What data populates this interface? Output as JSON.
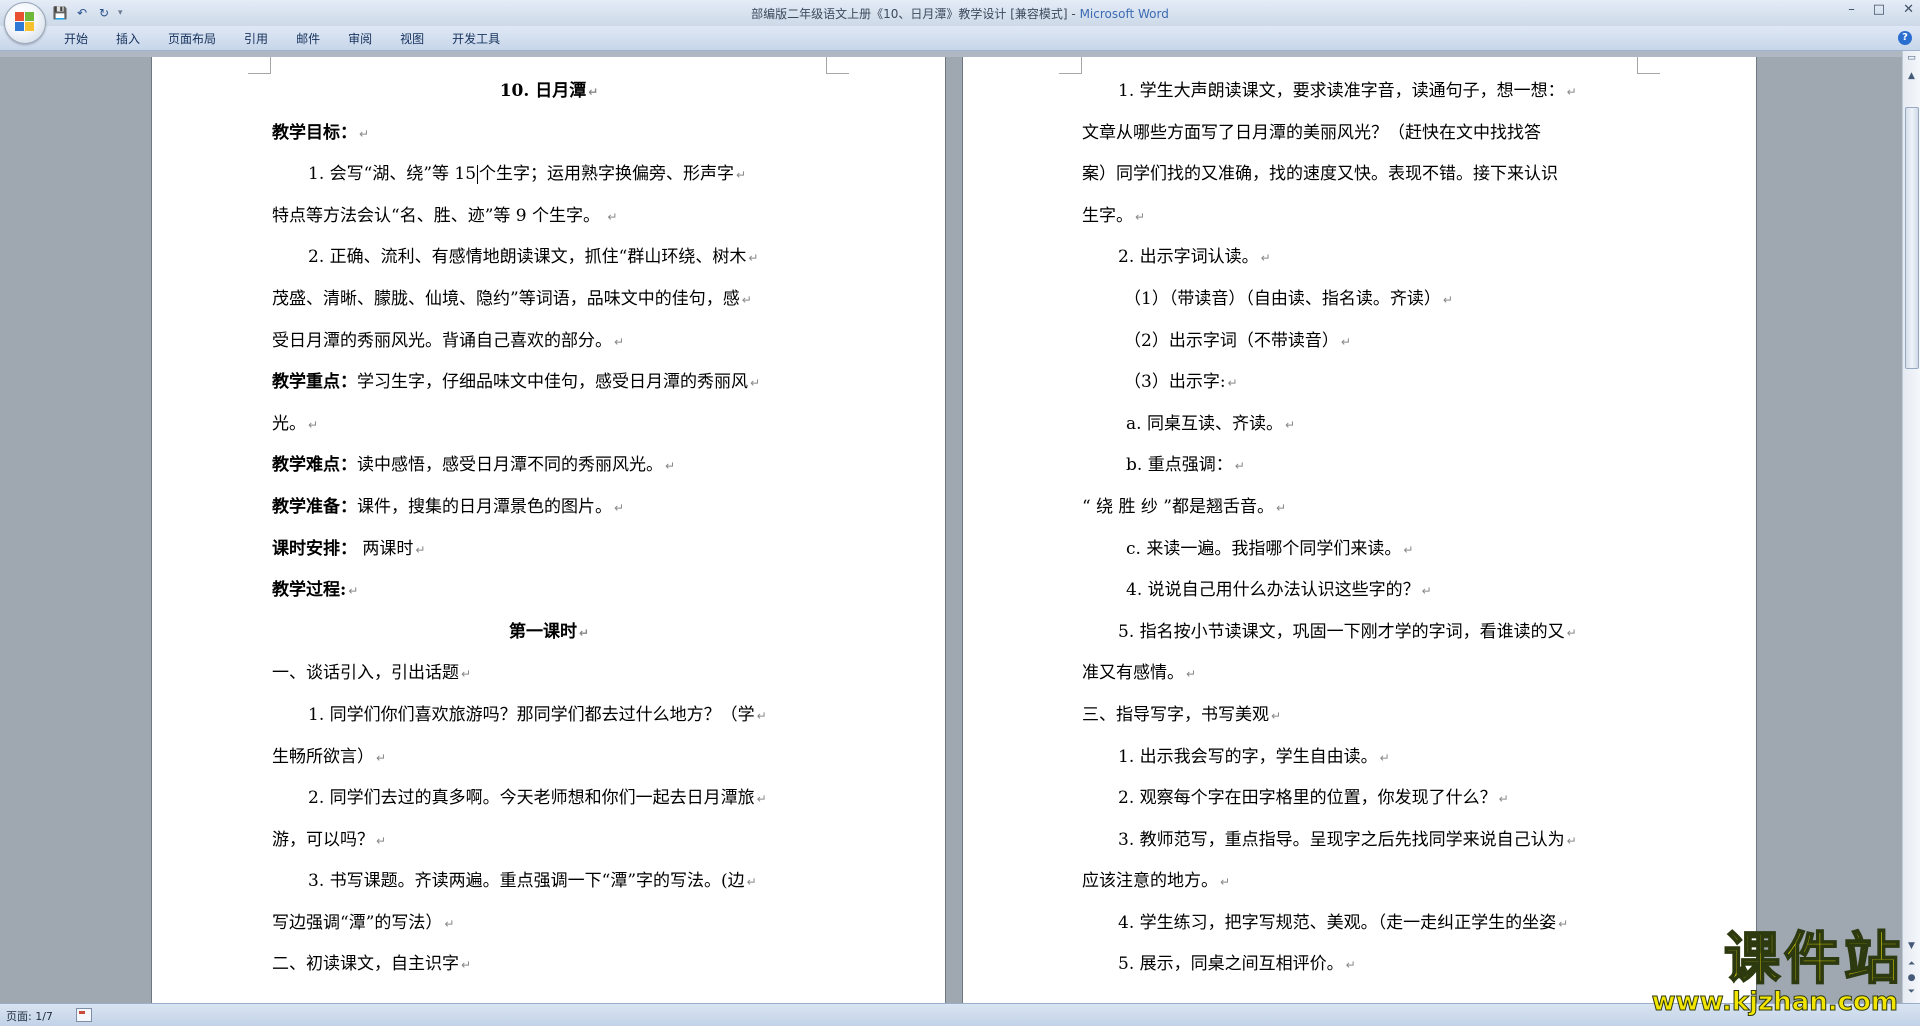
{
  "window": {
    "title": "部编版二年级语文上册《10、日月潭》教学设计 [兼容模式] - ",
    "app_name": "Microsoft Word",
    "controls": [
      "–",
      "□",
      "✕"
    ]
  },
  "quick_access": {
    "save_icon": "💾",
    "undo_icon": "↶",
    "redo_icon": "↻",
    "customize_icon": "▾"
  },
  "ribbon": {
    "tabs": [
      "开始",
      "插入",
      "页面布局",
      "引用",
      "邮件",
      "审阅",
      "视图",
      "开发工具"
    ],
    "help": "?"
  },
  "document": {
    "left_page": [
      {
        "text": "10. 日月潭",
        "style": "title"
      },
      {
        "label": "教学目标：",
        "text": ""
      },
      {
        "text": "1. 会写“湖、绕”等 15",
        "caret": true,
        "text2": "个生字；运用熟字换偏旁、形声字",
        "style": "ind"
      },
      {
        "text": "特点等方法会认“名、胜、迹”等 9 个生字。 "
      },
      {
        "text": "2. 正确、流利、有感情地朗读课文，抓住“群山环绕、树木",
        "style": "ind"
      },
      {
        "text": "茂盛、清晰、朦胧、仙境、隐约”等词语，品味文中的佳句，感"
      },
      {
        "text": "受日月潭的秀丽风光。背诵自己喜欢的部分。"
      },
      {
        "label": "教学重点：",
        "text": "学习生字，仔细品味文中佳句，感受日月潭的秀丽风"
      },
      {
        "text": "光。"
      },
      {
        "label": "教学难点：",
        "text": "读中感悟，感受日月潭不同的秀丽风光。"
      },
      {
        "label": "教学准备：",
        "text": "课件，搜集的日月潭景色的图片。"
      },
      {
        "label": "课时安排：",
        "text": " 两课时"
      },
      {
        "label": "教学过程:",
        "text": ""
      },
      {
        "text": "第一课时",
        "style": "title"
      },
      {
        "text": "一、谈话引入，引出话题"
      },
      {
        "text": "1. 同学们你们喜欢旅游吗？那同学们都去过什么地方？（学",
        "style": "ind"
      },
      {
        "text": "生畅所欲言）"
      },
      {
        "text": "2. 同学们去过的真多啊。今天老师想和你们一起去日月潭旅",
        "style": "ind"
      },
      {
        "text": "游，可以吗？"
      },
      {
        "text": "3. 书写课题。齐读两遍。重点强调一下“潭”字的写法。(边",
        "style": "ind"
      },
      {
        "text": "写边强调“潭”的写法）"
      },
      {
        "text": "二、初读课文，自主识字"
      }
    ],
    "right_page": [
      {
        "text": "1. 学生大声朗读课文，要求读准字音，读通句子，想一想：",
        "style": "ind"
      },
      {
        "text": "文章从哪些方面写了日月潭的美丽风光？（赶快在文中找找答",
        "mark": false
      },
      {
        "text": "案）同学们找的又准确，找的速度又快。表现不错。接下来认识",
        "mark": false
      },
      {
        "text": "生字。"
      },
      {
        "text": "2. 出示字词认读。",
        "style": "ind"
      },
      {
        "text": "（1）（带读音）（自由读、指名读。齐读）",
        "style": "ind3"
      },
      {
        "text": "（2）出示字词（不带读音）",
        "style": "ind3"
      },
      {
        "text": "（3）出示字:",
        "style": "ind3"
      },
      {
        "text": "a. 同桌互读、齐读。",
        "style": "ind2"
      },
      {
        "text": "b. 重点强调：",
        "style": "ind2"
      },
      {
        "text": "“ 绕 胜 纱 ”都是翘舌音。"
      },
      {
        "text": "c. 来读一遍。我指哪个同学们来读。",
        "style": "ind2"
      },
      {
        "text": "4. 说说自己用什么办法认识这些字的？",
        "style": "ind2"
      },
      {
        "text": "5. 指名按小节读课文，巩固一下刚才学的字词，看谁读的又",
        "style": "ind"
      },
      {
        "text": "准又有感情。"
      },
      {
        "text": "三、指导写字，书写美观"
      },
      {
        "text": "1. 出示我会写的字，学生自由读。",
        "style": "ind"
      },
      {
        "text": "2. 观察每个字在田字格里的位置，你发现了什么？",
        "style": "ind"
      },
      {
        "text": "3. 教师范写，重点指导。呈现字之后先找同学来说自己认为",
        "style": "ind"
      },
      {
        "text": "应该注意的地方。"
      },
      {
        "text": "4. 学生练习，把字写规范、美观。（走一走纠正学生的坐姿",
        "style": "ind"
      },
      {
        "text": "5. 展示，同桌之间互相评价。",
        "style": "ind"
      }
    ],
    "paragraph_mark": "↵"
  },
  "status_bar": {
    "page": "页面: 1/7"
  },
  "watermark": {
    "big": "课件站",
    "small": "www.kjzhan.com"
  },
  "colors": {
    "accent": "#3c6bb3",
    "watermark": "#f3e500",
    "workspace": "#9fa7b1"
  }
}
